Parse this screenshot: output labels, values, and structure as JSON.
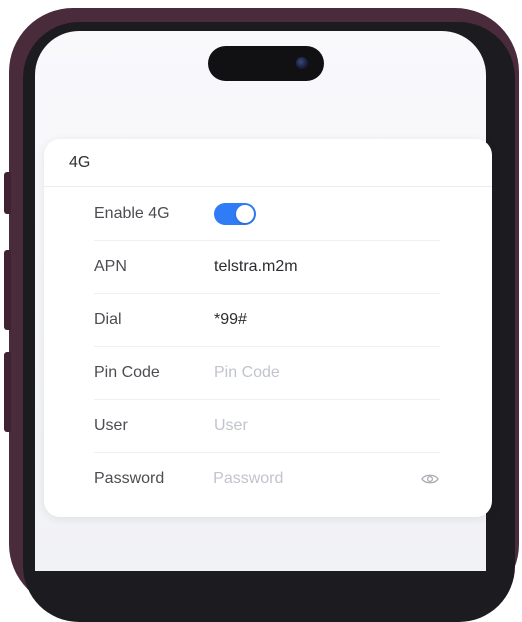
{
  "card": {
    "title": "4G",
    "fields": [
      {
        "label": "Enable 4G",
        "type": "toggle",
        "checked": true
      },
      {
        "label": "APN",
        "value": "telstra.m2m"
      },
      {
        "label": "Dial",
        "value": "*99#"
      },
      {
        "label": "Pin Code",
        "placeholder": "Pin Code"
      },
      {
        "label": "User",
        "placeholder": "User"
      },
      {
        "label": "Password",
        "placeholder": "Password"
      }
    ]
  },
  "icons": {
    "password_toggle": "eye-icon"
  },
  "colors": {
    "accent": "#2f7cf6",
    "phone_frame": "#4a2b3b"
  }
}
